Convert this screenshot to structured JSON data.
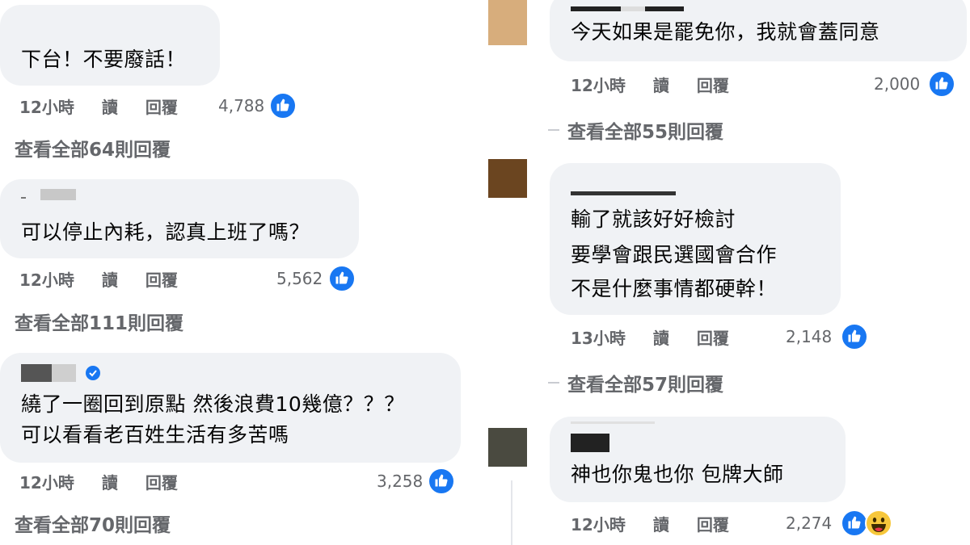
{
  "colors": {
    "like_blue": "#1877f2",
    "bubble_bg": "#f0f2f5",
    "meta_gray": "#65676b"
  },
  "left": [
    {
      "author": "",
      "lines": [
        "下台！不要廢話！"
      ],
      "time": "12小時",
      "read": "讀",
      "reply": "回覆",
      "likes": "4,788",
      "view_replies": "查看全部64則回覆"
    },
    {
      "author": "",
      "lines": [
        "可以停止內耗，認真上班了嗎？"
      ],
      "time": "12小時",
      "read": "讀",
      "reply": "回覆",
      "likes": "5,562",
      "view_replies": "查看全部111則回覆"
    },
    {
      "author": "",
      "verified": true,
      "lines": [
        "繞了一圈回到原點 然後浪費10幾億？？？",
        "可以看看老百姓生活有多苦嗎"
      ],
      "time": "12小時",
      "read": "讀",
      "reply": "回覆",
      "likes": "3,258",
      "view_replies": "查看全部70則回覆"
    }
  ],
  "right": [
    {
      "author": "",
      "lines": [
        "今天如果是罷免你，我就會蓋同意"
      ],
      "time": "12小時",
      "read": "讀",
      "reply": "回覆",
      "likes": "2,000",
      "view_replies": "查看全部55則回覆"
    },
    {
      "author": "",
      "lines": [
        "輸了就該好好檢討",
        "要學會跟民選國會合作",
        "不是什麼事情都硬幹！"
      ],
      "time": "13小時",
      "read": "讀",
      "reply": "回覆",
      "likes": "2,148",
      "view_replies": "查看全部57則回覆"
    },
    {
      "author": "",
      "lines": [
        "神也你鬼也你 包牌大師"
      ],
      "time": "12小時",
      "read": "讀",
      "reply": "回覆",
      "likes": "2,274",
      "reactions": [
        "like-icon",
        "haha-icon"
      ]
    }
  ]
}
